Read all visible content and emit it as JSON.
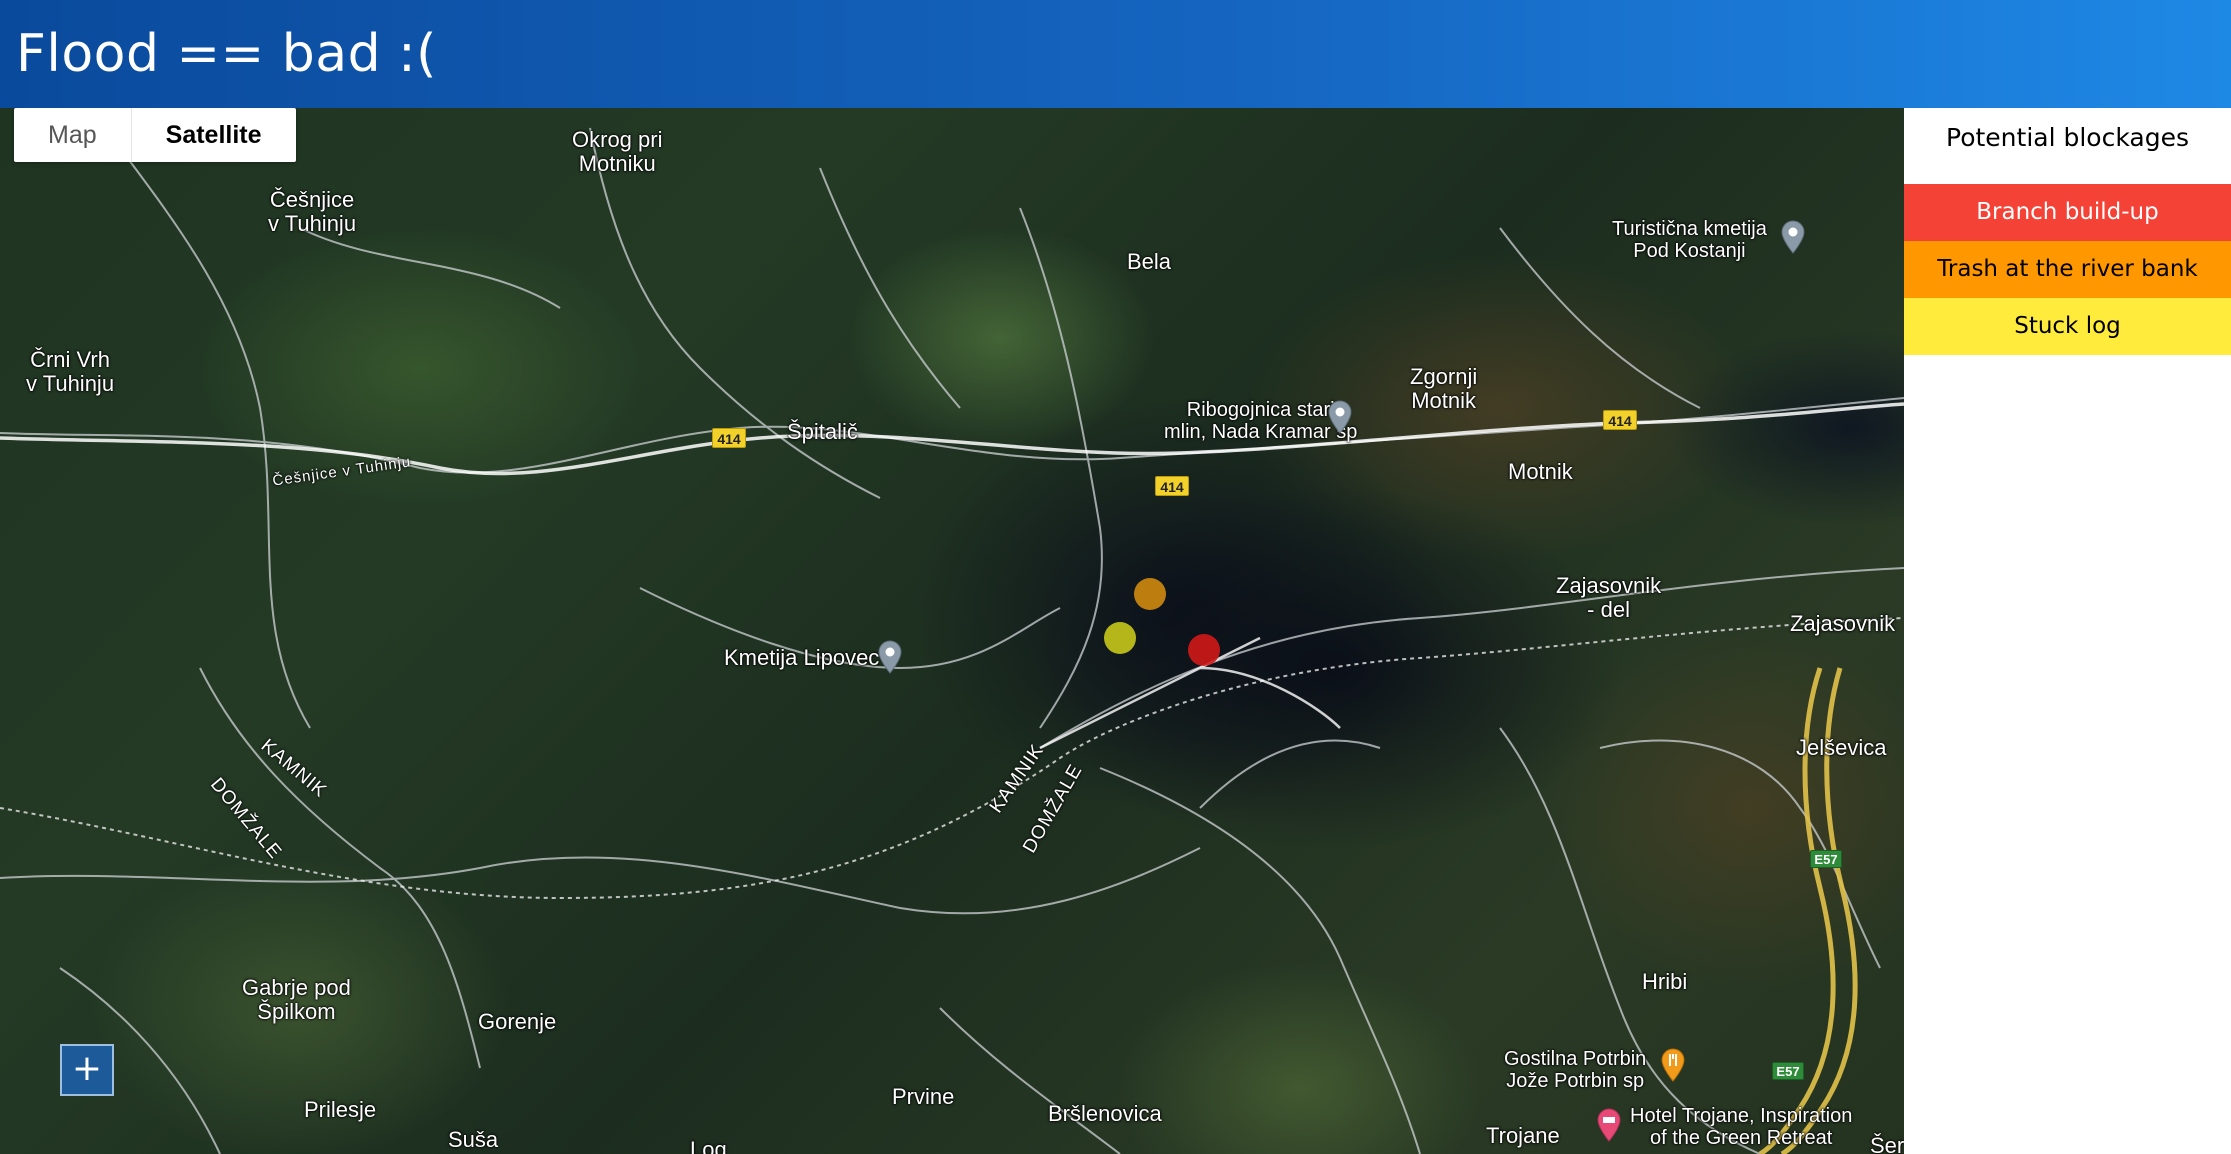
{
  "header": {
    "title": "Flood == bad :("
  },
  "map_type": {
    "map_label": "Map",
    "satellite_label": "Satellite",
    "selected": "Satellite"
  },
  "places": {
    "okrog": "Okrog pri\nMotniku",
    "cesnjice": "Češnjice\nv Tuhinju",
    "crni_vrh": "Črni Vrh\nv Tuhinju",
    "bela": "Bela",
    "spitalic": "Špitalič",
    "ribogojnica": "Ribogojnica stari\nmlin, Nada Kramar sp",
    "zgornji_motnik": "Zgornji\nMotnik",
    "motnik": "Motnik",
    "turisticna": "Turistična kmetija\nPod Kostanji",
    "zajasovnik_del": "Zajasovnik\n- del",
    "zajasovnik": "Zajasovnik",
    "kmetija_lipovec": "Kmetija Lipovec",
    "jelsevica": "Jelševica",
    "hribi": "Hribi",
    "gostilna": "Gostilna Potrbin\nJože Potrbin sp",
    "hotel": "Hotel Trojane, Inspiration\nof the Green Retreat",
    "trojane": "Trojane",
    "brslenovica": "Bršlenovica",
    "prvine": "Prvine",
    "gorenje": "Gorenje",
    "gabrje": "Gabrje pod\nŠpilkom",
    "prilesje": "Prilesje",
    "susa": "Suša",
    "log": "Log",
    "ser": "Šer"
  },
  "road_labels": {
    "cesnjice_road": "Češnjice v Tuhinju",
    "kamnik_left": "KAMNIK",
    "domzale_left": "DOMŽALE",
    "kamnik_mid": "KAMNIK",
    "domzale_mid": "DOMŽALE"
  },
  "shields": {
    "r414": "414",
    "e57": "E57"
  },
  "zoom": {
    "in_label": "+"
  },
  "panel": {
    "title": "Potential blockages",
    "legend": [
      {
        "label": "Branch build-up",
        "color": "#f44336",
        "text_color": "#ffffff"
      },
      {
        "label": "Trash at the river bank",
        "color": "#ff9800",
        "text_color": "#000000"
      },
      {
        "label": "Stuck log",
        "color": "#ffeb3b",
        "text_color": "#000000"
      }
    ]
  },
  "markers": [
    {
      "type": "Trash at the river bank",
      "color": "#d08a10"
    },
    {
      "type": "Stuck log",
      "color": "#c8c81a"
    },
    {
      "type": "Branch build-up",
      "color": "#d01818"
    }
  ]
}
